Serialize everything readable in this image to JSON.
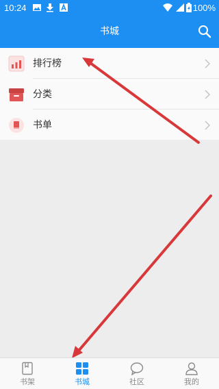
{
  "status_bar": {
    "time": "10:24",
    "battery_percent": "100%",
    "icons": [
      "image-icon",
      "download-icon",
      "a-icon",
      "wifi-icon",
      "signal-icon",
      "battery-icon"
    ]
  },
  "header": {
    "title": "书城",
    "search_icon": "search-icon"
  },
  "menu": {
    "items": [
      {
        "label": "排行榜",
        "icon": "ranking-icon"
      },
      {
        "label": "分类",
        "icon": "category-icon"
      },
      {
        "label": "书单",
        "icon": "booklist-icon"
      }
    ]
  },
  "tab_bar": {
    "tabs": [
      {
        "label": "书架",
        "icon": "bookshelf-icon",
        "active": false
      },
      {
        "label": "书城",
        "icon": "bookstore-icon",
        "active": true
      },
      {
        "label": "社区",
        "icon": "community-icon",
        "active": false
      },
      {
        "label": "我的",
        "icon": "profile-icon",
        "active": false
      }
    ]
  },
  "colors": {
    "primary": "#1d8ff2",
    "annotation_arrow": "#d9383a",
    "background": "#ededed"
  }
}
